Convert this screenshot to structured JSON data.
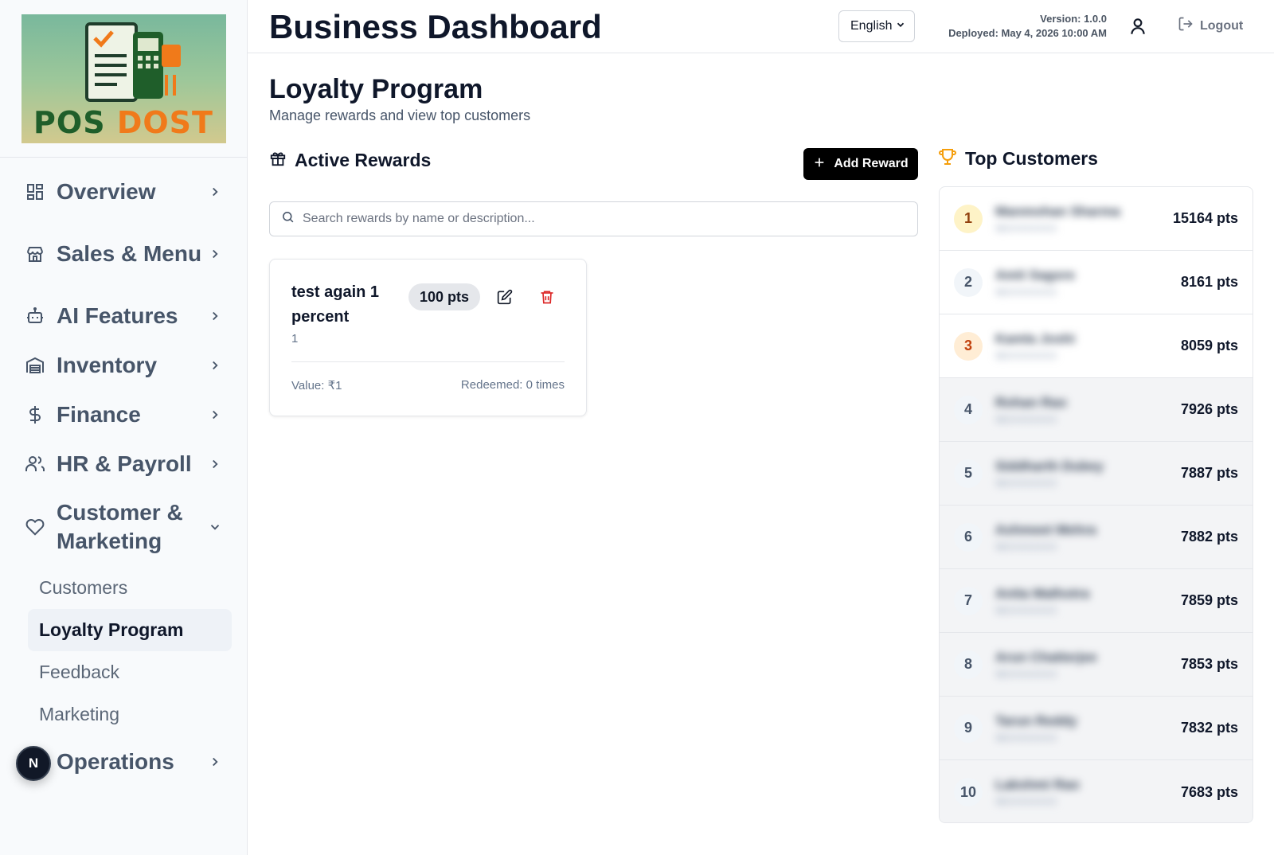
{
  "sidebar": {
    "logo": {
      "text_pos": "POS",
      "text_dost": "DOST"
    },
    "items": [
      {
        "label": "Overview",
        "icon": "grid-icon"
      },
      {
        "label": "Sales & Menu",
        "icon": "store-icon"
      },
      {
        "label": "AI Features",
        "icon": "bot-icon"
      },
      {
        "label": "Inventory",
        "icon": "warehouse-icon"
      },
      {
        "label": "Finance",
        "icon": "dollar-icon"
      },
      {
        "label": "HR & Payroll",
        "icon": "users-icon"
      },
      {
        "label": "Customer & Marketing",
        "icon": "heart-icon",
        "expanded": true,
        "children": [
          {
            "label": "Customers"
          },
          {
            "label": "Loyalty Program",
            "active": true
          },
          {
            "label": "Feedback"
          },
          {
            "label": "Marketing"
          }
        ]
      },
      {
        "label": "Operations",
        "icon": "operations-icon"
      }
    ],
    "dev_badge": "N"
  },
  "header": {
    "title": "Business Dashboard",
    "language": "English",
    "version": "Version: 1.0.0",
    "deployed": "Deployed: May 4, 2026 10:00 AM",
    "logout": "Logout"
  },
  "page": {
    "title": "Loyalty Program",
    "subtitle": "Manage rewards and view top customers"
  },
  "rewards": {
    "title": "Active Rewards",
    "add_label": "Add Reward",
    "search_placeholder": "Search rewards by name or description...",
    "items": [
      {
        "name": "test again 1 percent",
        "description": "1",
        "points": "100 pts",
        "value": "Value: ₹1",
        "redeemed": "Redeemed: 0 times"
      }
    ]
  },
  "top_customers": {
    "title": "Top Customers",
    "icon": "trophy-icon",
    "accent": "#f59e0b",
    "rows": [
      {
        "rank": "1",
        "name": "Manmohan Sharma",
        "phone": "98XXXXXXXX",
        "points": "15164 pts"
      },
      {
        "rank": "2",
        "name": "Amit Sagore",
        "phone": "98XXXXXXXX",
        "points": "8161 pts"
      },
      {
        "rank": "3",
        "name": "Kamla Joshi",
        "phone": "98XXXXXXXX",
        "points": "8059 pts"
      },
      {
        "rank": "4",
        "name": "Rohan Rao",
        "phone": "98XXXXXXXX",
        "points": "7926 pts"
      },
      {
        "rank": "5",
        "name": "Siddharth Dubey",
        "phone": "98XXXXXXXX",
        "points": "7887 pts"
      },
      {
        "rank": "6",
        "name": "Ashmeet Mehra",
        "phone": "98XXXXXXXX",
        "points": "7882 pts"
      },
      {
        "rank": "7",
        "name": "Anita Malhotra",
        "phone": "98XXXXXXXX",
        "points": "7859 pts"
      },
      {
        "rank": "8",
        "name": "Arun Chatterjee",
        "phone": "98XXXXXXXX",
        "points": "7853 pts"
      },
      {
        "rank": "9",
        "name": "Tarun Reddy",
        "phone": "98XXXXXXXX",
        "points": "7832 pts"
      },
      {
        "rank": "10",
        "name": "Lakshmi Rao",
        "phone": "98XXXXXXXX",
        "points": "7683 pts"
      }
    ]
  }
}
